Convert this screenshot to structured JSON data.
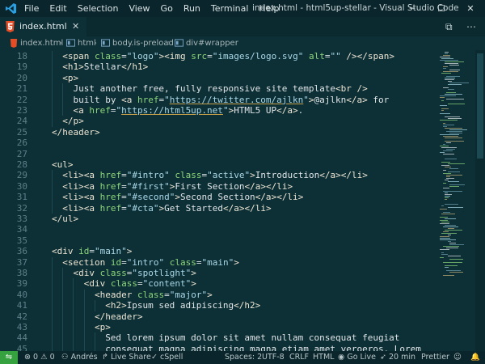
{
  "titlebar": {
    "menu": [
      "File",
      "Edit",
      "Selection",
      "View",
      "Go",
      "Run",
      "Terminal",
      "Help"
    ],
    "title": "index.html - html5up-stellar - Visual Studio Code",
    "minimize": "─",
    "maximize": "☐",
    "close": "✕"
  },
  "tab": {
    "name": "index.html",
    "close": "✕"
  },
  "tab_actions": {
    "split": "⧉",
    "more": "⋯"
  },
  "breadcrumb": [
    "index.html",
    "html",
    "body.is-preload",
    "div#wrapper"
  ],
  "editor": {
    "line_numbers": [
      18,
      19,
      20,
      21,
      22,
      23,
      24,
      25,
      26,
      27,
      28,
      29,
      30,
      31,
      32,
      33,
      34,
      35,
      36,
      37,
      38,
      39,
      40,
      41,
      42,
      43,
      44,
      45
    ],
    "lines": [
      "<span class=\"logo\"><img src=\"images/logo.svg\" alt=\"\" /></span>",
      "<h1>Stellar</h1>",
      "<p>",
      "Just another free, fully responsive site template<br />",
      "built by <a href=\"https://twitter.com/ajlkn\">@ajlkn</a> for",
      "<a href=\"https://html5up.net\">HTML5 UP</a>.",
      "</p>",
      "</header>",
      "",
      "",
      "<ul>",
      "<li><a href=\"#intro\" class=\"active\">Introduction</a></li>",
      "<li><a href=\"#first\">First Section</a></li>",
      "<li><a href=\"#second\">Second Section</a></li>",
      "<li><a href=\"#cta\">Get Started</a></li>",
      "</ul>",
      "",
      "",
      "<div id=\"main\">",
      "<section id=\"intro\" class=\"main\">",
      "<div class=\"spotlight\">",
      "<div class=\"content\">",
      "<header class=\"major\">",
      "<h2>Ipsum sed adipiscing</h2>",
      "</header>",
      "<p>",
      "Sed lorem ipsum dolor sit amet nullam consequat feugiat",
      "consequat magna adipiscing magna etiam amet veroeros. Lorem"
    ]
  },
  "statusbar": {
    "errors": "0",
    "warnings": "0",
    "user": "Andrés",
    "live_share": "Live Share",
    "cspell": "cSpell",
    "spaces": "Spaces: 2",
    "encoding": "UTF-8",
    "eol": "CRLF",
    "language": "HTML",
    "go_live": "Go Live",
    "time": "20 min",
    "prettier": "Prettier"
  },
  "colors": {
    "editor_bg": "#0d2f36",
    "titlebar_bg": "#0a252b",
    "remote_green": "#35a13f",
    "attr_green": "#8cd67a",
    "string_blue": "#a8d8e8",
    "html5_orange": "#e44d26"
  }
}
